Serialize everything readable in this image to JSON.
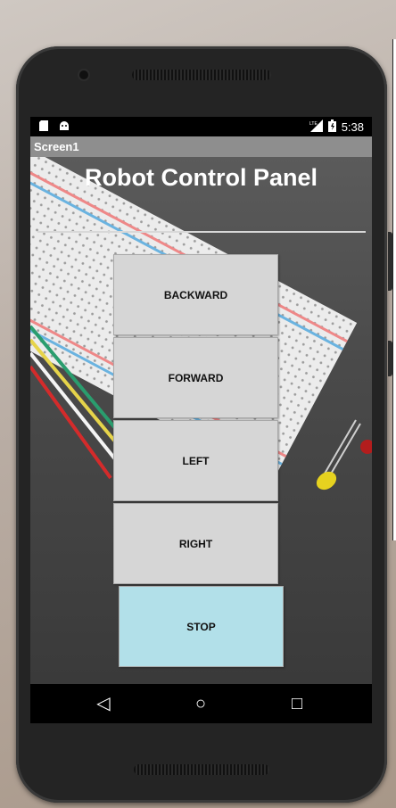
{
  "status_bar": {
    "time": "5:38",
    "network": "LTE",
    "icons": [
      "sd-card-icon",
      "android-icon",
      "signal-icon",
      "battery-icon"
    ]
  },
  "app_bar": {
    "title": "Screen1"
  },
  "main": {
    "heading": "Robot Control Panel",
    "buttons": [
      {
        "label": "BACKWARD"
      },
      {
        "label": "FORWARD"
      },
      {
        "label": "LEFT"
      },
      {
        "label": "RIGHT"
      },
      {
        "label": "STOP"
      }
    ]
  },
  "nav_bar": {
    "back_glyph": "◁",
    "home_glyph": "○",
    "recents_glyph": "□"
  },
  "colors": {
    "stop_button": "#b2e0e9",
    "button": "#d6d6d6",
    "title_bar": "#8e8e8e"
  }
}
